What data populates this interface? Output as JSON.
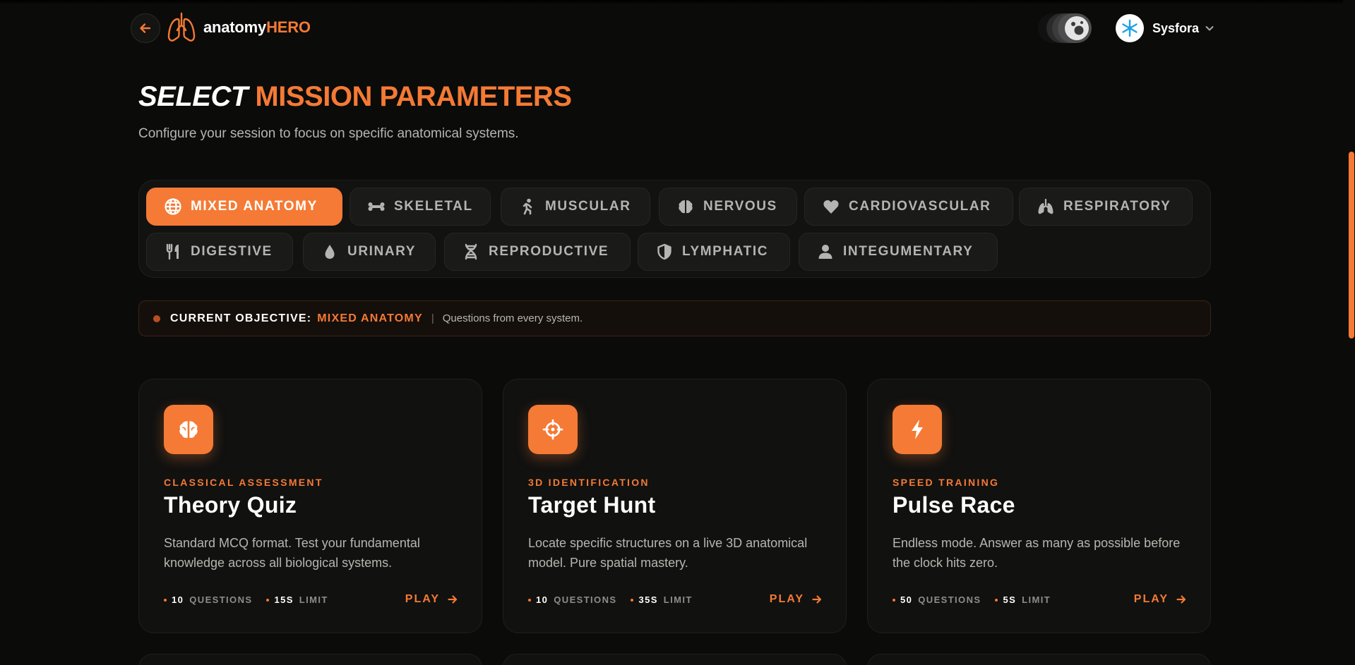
{
  "header": {
    "logo_part1": "anatomy",
    "logo_part2": "HERO",
    "user_name": "Sysfora",
    "icons": {
      "back": "arrow-left-icon",
      "logo": "lungs-icon",
      "theme": "theme-toggle-icon",
      "avatar": "snowflake-icon",
      "dropdown": "chevron-down-icon"
    }
  },
  "title": {
    "part1": "SELECT",
    "part2": "MISSION PARAMETERS",
    "subtitle": "Configure your session to focus on specific anatomical systems."
  },
  "filters": [
    {
      "label": "MIXED ANATOMY",
      "icon": "globe-icon",
      "active": true
    },
    {
      "label": "SKELETAL",
      "icon": "bone-icon",
      "active": false
    },
    {
      "label": "MUSCULAR",
      "icon": "running-person-icon",
      "active": false
    },
    {
      "label": "NERVOUS",
      "icon": "brain-icon",
      "active": false
    },
    {
      "label": "CARDIOVASCULAR",
      "icon": "heart-icon",
      "active": false
    },
    {
      "label": "RESPIRATORY",
      "icon": "lungs-icon",
      "active": false
    },
    {
      "label": "DIGESTIVE",
      "icon": "utensils-icon",
      "active": false
    },
    {
      "label": "URINARY",
      "icon": "droplet-icon",
      "active": false
    },
    {
      "label": "REPRODUCTIVE",
      "icon": "dna-icon",
      "active": false
    },
    {
      "label": "LYMPHATIC",
      "icon": "shield-icon",
      "active": false
    },
    {
      "label": "INTEGUMENTARY",
      "icon": "user-icon",
      "active": false
    }
  ],
  "objective": {
    "label": "CURRENT OBJECTIVE:",
    "value": "MIXED ANATOMY",
    "separator": "|",
    "description": "Questions from every system."
  },
  "cards": [
    {
      "icon": "brain-icon",
      "tag": "CLASSICAL ASSESSMENT",
      "title": "Theory Quiz",
      "description": "Standard MCQ format. Test your fundamental knowledge across all biological systems.",
      "questions": "10",
      "questions_label": "QUESTIONS",
      "limit": "15S",
      "limit_label": "LIMIT",
      "play": "PLAY"
    },
    {
      "icon": "crosshair-icon",
      "tag": "3D IDENTIFICATION",
      "title": "Target Hunt",
      "description": "Locate specific structures on a live 3D anatomical model. Pure spatial mastery.",
      "questions": "10",
      "questions_label": "QUESTIONS",
      "limit": "35S",
      "limit_label": "LIMIT",
      "play": "PLAY"
    },
    {
      "icon": "lightning-bolt-icon",
      "tag": "SPEED TRAINING",
      "title": "Pulse Race",
      "description": "Endless mode. Answer as many as possible before the clock hits zero.",
      "questions": "50",
      "questions_label": "QUESTIONS",
      "limit": "5S",
      "limit_label": "LIMIT",
      "play": "PLAY"
    }
  ],
  "colors": {
    "accent": "#f47a35",
    "background": "#0b0b0a",
    "card": "#111110",
    "muted_text": "#b6b6b0"
  }
}
